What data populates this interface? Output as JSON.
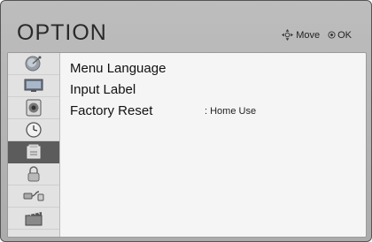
{
  "header": {
    "title": "OPTION",
    "move_label": "Move",
    "ok_label": "OK",
    "move_icon": "four-way-arrow-icon",
    "ok_icon": "ok-button-icon"
  },
  "sidebar": {
    "tabs": [
      {
        "icon": "satellite-dish-icon",
        "active": false
      },
      {
        "icon": "monitor-icon",
        "active": false
      },
      {
        "icon": "speaker-icon",
        "active": false
      },
      {
        "icon": "clock-icon",
        "active": false
      },
      {
        "icon": "option-box-icon",
        "active": true
      },
      {
        "icon": "lock-icon",
        "active": false
      },
      {
        "icon": "input-cable-icon",
        "active": false
      },
      {
        "icon": "media-player-icon",
        "active": false
      }
    ]
  },
  "menu": {
    "items": [
      {
        "label": "Menu Language",
        "value": ""
      },
      {
        "label": "Input Label",
        "value": ""
      },
      {
        "label": "Factory Reset",
        "value": ": Home Use"
      }
    ]
  },
  "colors": {
    "frame": "#b3b3b3",
    "content_bg": "#f5f5f5",
    "sidebar_bg": "#e2e2e2",
    "active_tab": "#5c5c5c"
  }
}
